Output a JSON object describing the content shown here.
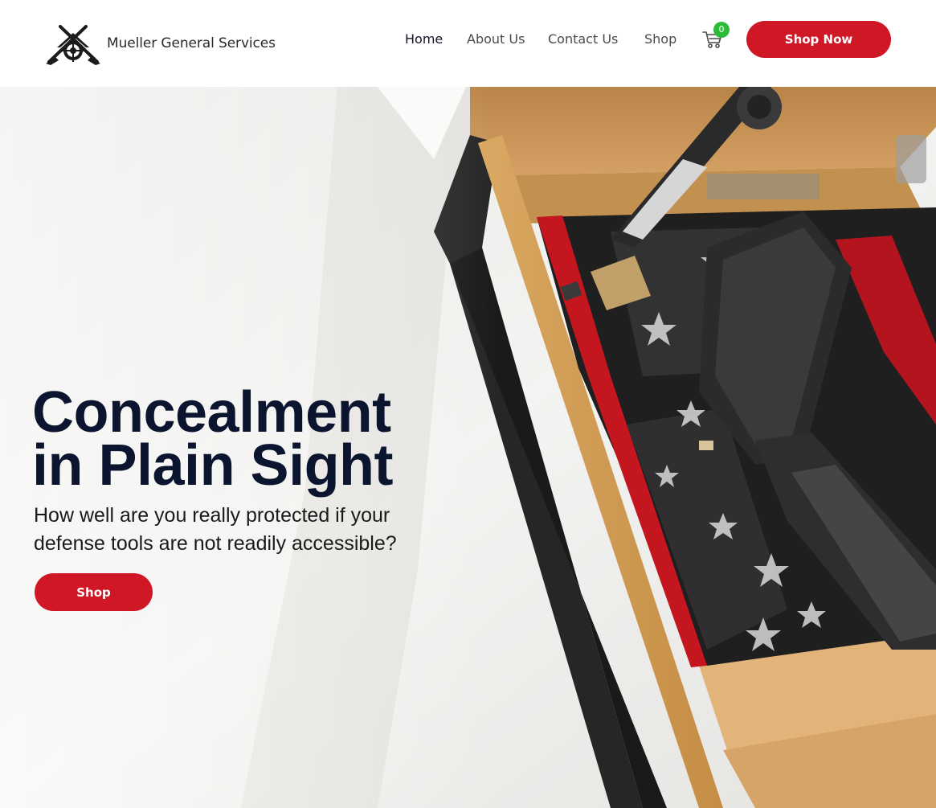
{
  "brand": {
    "name": "Mueller General Services",
    "logo_icon": "crossed-rifles-crosshair-house-icon"
  },
  "nav": {
    "items": [
      {
        "label": "Home",
        "active": true
      },
      {
        "label": "About Us",
        "active": false
      },
      {
        "label": "Contact Us",
        "active": false
      },
      {
        "label": "Shop",
        "active": false
      }
    ]
  },
  "cart": {
    "icon": "shopping-cart-icon",
    "count": "0"
  },
  "header_cta": {
    "label": "Shop Now"
  },
  "hero": {
    "title_line1": "Concealment",
    "title_line2": "in Plain Sight",
    "subtitle": "How well are you really protected if your defense tools are not readily accessible?",
    "cta_label": "Shop",
    "image": "hidden-gun-shelf-compartment-photo"
  },
  "colors": {
    "accent": "#cf1726",
    "title": "#0c1530",
    "badge": "#2bbd3a"
  }
}
